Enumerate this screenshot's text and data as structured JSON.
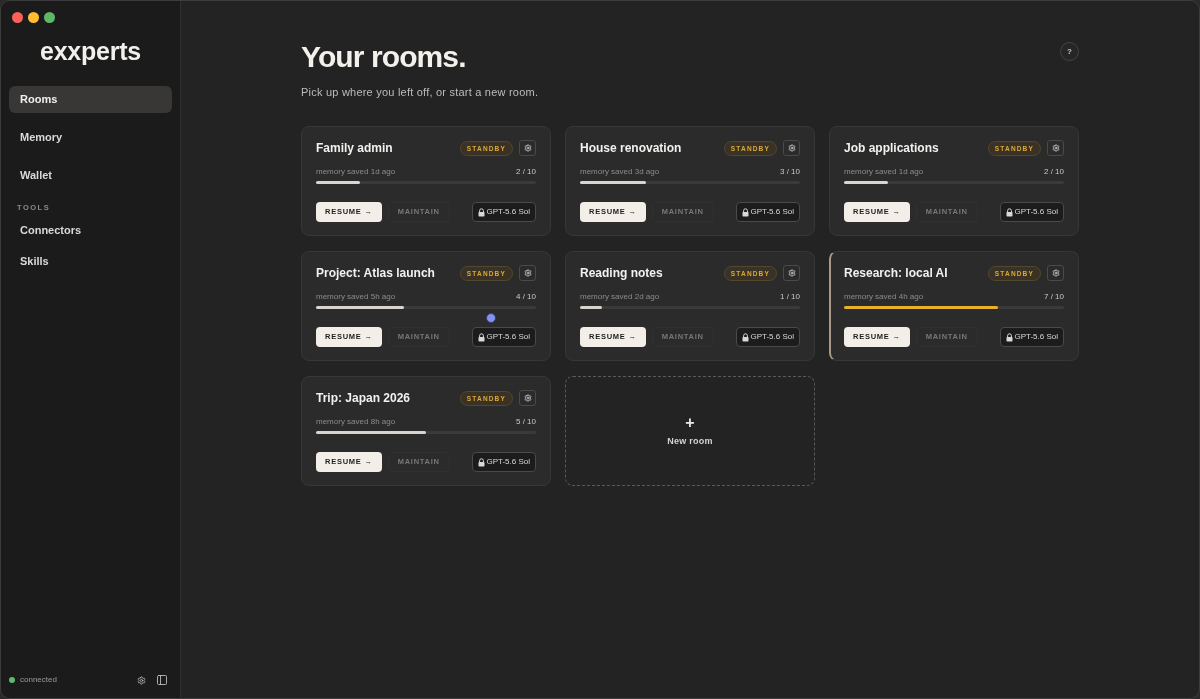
{
  "sidebar": {
    "logo": "exxperts",
    "nav": [
      {
        "label": "Rooms",
        "selected": true
      },
      {
        "label": "Memory",
        "selected": false
      },
      {
        "label": "Wallet",
        "selected": false
      }
    ],
    "section_label": "TOOLS",
    "tools": [
      {
        "label": "Connectors",
        "selected": false
      },
      {
        "label": "Skills",
        "selected": false
      }
    ],
    "status": {
      "text": "connected",
      "connected": true
    }
  },
  "header": {
    "title": "Your rooms.",
    "subtitle": "Pick up where you left off, or start a new room.",
    "help": "?"
  },
  "rooms": [
    {
      "name": "Family admin",
      "status": "STANDBY",
      "saved": "memory saved 1d ago",
      "count": "2 / 10",
      "level": 0.2,
      "resume": "RESUME →",
      "maintain": "MAINTAIN",
      "model": "GPT-5.6 Sol",
      "active": false,
      "cursor": false
    },
    {
      "name": "House renovation",
      "status": "STANDBY",
      "saved": "memory saved 3d ago",
      "count": "3 / 10",
      "level": 0.3,
      "resume": "RESUME →",
      "maintain": "MAINTAIN",
      "model": "GPT-5.6 Sol",
      "active": false,
      "cursor": false
    },
    {
      "name": "Job applications",
      "status": "STANDBY",
      "saved": "memory saved 1d ago",
      "count": "2 / 10",
      "level": 0.2,
      "resume": "RESUME →",
      "maintain": "MAINTAIN",
      "model": "GPT-5.6 Sol",
      "active": false,
      "cursor": false
    },
    {
      "name": "Project: Atlas launch",
      "status": "STANDBY",
      "saved": "memory saved 5h ago",
      "count": "4 / 10",
      "level": 0.4,
      "resume": "RESUME →",
      "maintain": "MAINTAIN",
      "model": "GPT-5.6 Sol",
      "active": false,
      "cursor": true
    },
    {
      "name": "Reading notes",
      "status": "STANDBY",
      "saved": "memory saved 2d ago",
      "count": "1 / 10",
      "level": 0.1,
      "resume": "RESUME →",
      "maintain": "MAINTAIN",
      "model": "GPT-5.6 Sol",
      "active": false,
      "cursor": false
    },
    {
      "name": "Research: local AI",
      "status": "STANDBY",
      "saved": "memory saved 4h ago",
      "count": "7 / 10",
      "level": 0.7,
      "resume": "RESUME →",
      "maintain": "MAINTAIN",
      "model": "GPT-5.6 Sol",
      "active": true,
      "cursor": false
    },
    {
      "name": "Trip: Japan 2026",
      "status": "STANDBY",
      "saved": "memory saved 8h ago",
      "count": "5 / 10",
      "level": 0.5,
      "resume": "RESUME →",
      "maintain": "MAINTAIN",
      "model": "GPT-5.6 Sol",
      "active": false,
      "cursor": false
    }
  ],
  "new_room": {
    "icon": "+",
    "label": "New room"
  }
}
